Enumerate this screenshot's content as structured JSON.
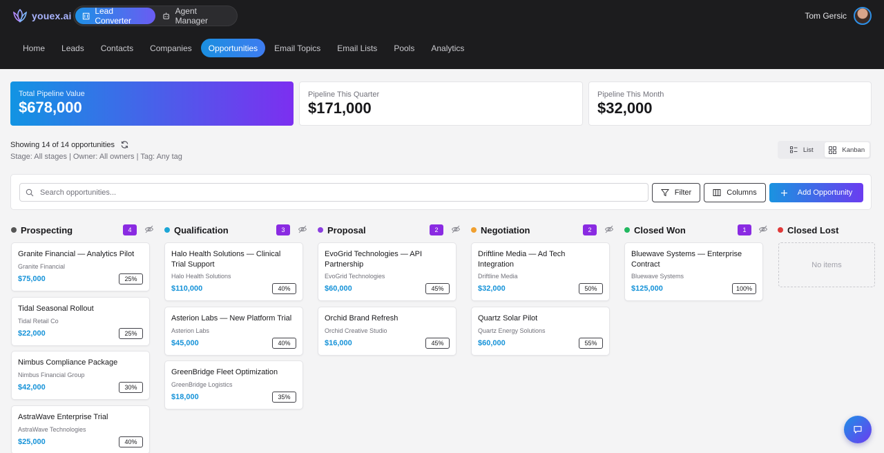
{
  "brand": {
    "name": "youex.ai"
  },
  "apps": [
    {
      "label": "Lead Converter",
      "icon": "building-icon",
      "active": true
    },
    {
      "label": "Agent Manager",
      "icon": "robot-icon",
      "active": false
    }
  ],
  "user": {
    "name": "Tom Gersic"
  },
  "nav": [
    {
      "label": "Home"
    },
    {
      "label": "Leads"
    },
    {
      "label": "Contacts"
    },
    {
      "label": "Companies"
    },
    {
      "label": "Opportunities",
      "active": true
    },
    {
      "label": "Email Topics"
    },
    {
      "label": "Email Lists"
    },
    {
      "label": "Pools"
    },
    {
      "label": "Analytics"
    }
  ],
  "stats": [
    {
      "label": "Total Pipeline Value",
      "value": "$678,000"
    },
    {
      "label": "Pipeline This Quarter",
      "value": "$171,000"
    },
    {
      "label": "Pipeline This Month",
      "value": "$32,000"
    }
  ],
  "summary": {
    "showing": "Showing 14 of 14 opportunities",
    "filters": "Stage: All stages | Owner: All owners | Tag: Any tag"
  },
  "view_toggle": {
    "list": "List",
    "kanban": "Kanban",
    "active": "kanban"
  },
  "toolbar": {
    "search_placeholder": "Search opportunities...",
    "filter": "Filter",
    "columns": "Columns",
    "add": "Add Opportunity"
  },
  "columns": [
    {
      "title": "Prospecting",
      "count": "4",
      "color": "#555555",
      "cards": [
        {
          "title": "Granite Financial — Analytics Pilot",
          "company": "Granite Financial",
          "amount": "$75,000",
          "prob": "25%"
        },
        {
          "title": "Tidal Seasonal Rollout",
          "company": "Tidal Retail Co",
          "amount": "$22,000",
          "prob": "25%"
        },
        {
          "title": "Nimbus Compliance Package",
          "company": "Nimbus Financial Group",
          "amount": "$42,000",
          "prob": "30%"
        },
        {
          "title": "AstraWave Enterprise Trial",
          "company": "AstraWave Technologies",
          "amount": "$25,000",
          "prob": "40%"
        }
      ]
    },
    {
      "title": "Qualification",
      "count": "3",
      "color": "#1ca6d6",
      "cards": [
        {
          "title": "Halo Health Solutions — Clinical Trial Support",
          "company": "Halo Health Solutions",
          "amount": "$110,000",
          "prob": "40%"
        },
        {
          "title": "Asterion Labs — New Platform Trial",
          "company": "Asterion Labs",
          "amount": "$45,000",
          "prob": "40%"
        },
        {
          "title": "GreenBridge Fleet Optimization",
          "company": "GreenBridge Logistics",
          "amount": "$18,000",
          "prob": "35%"
        }
      ]
    },
    {
      "title": "Proposal",
      "count": "2",
      "color": "#8b3fe0",
      "cards": [
        {
          "title": "EvoGrid Technologies — API Partnership",
          "company": "EvoGrid Technologies",
          "amount": "$60,000",
          "prob": "45%"
        },
        {
          "title": "Orchid Brand Refresh",
          "company": "Orchid Creative Studio",
          "amount": "$16,000",
          "prob": "45%"
        }
      ]
    },
    {
      "title": "Negotiation",
      "count": "2",
      "color": "#f0a030",
      "cards": [
        {
          "title": "Driftline Media — Ad Tech Integration",
          "company": "Driftline Media",
          "amount": "$32,000",
          "prob": "50%"
        },
        {
          "title": "Quartz Solar Pilot",
          "company": "Quartz Energy Solutions",
          "amount": "$60,000",
          "prob": "55%"
        }
      ]
    },
    {
      "title": "Closed Won",
      "count": "1",
      "color": "#22b860",
      "cards": [
        {
          "title": "Bluewave Systems — Enterprise Contract",
          "company": "Bluewave Systems",
          "amount": "$125,000",
          "prob": "100%"
        }
      ]
    },
    {
      "title": "Closed Lost",
      "color": "#e03a3a",
      "empty_text": "No items",
      "cards": []
    }
  ]
}
